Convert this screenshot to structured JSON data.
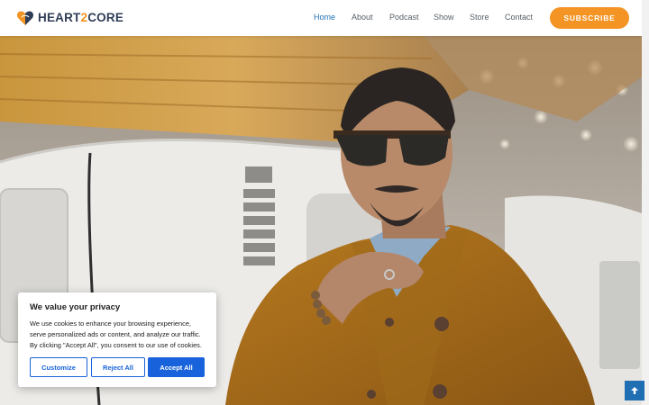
{
  "site": {
    "logo_main": "HEART",
    "logo_accent": "2",
    "logo_end": "CORE"
  },
  "nav": {
    "items": [
      {
        "label": "Home",
        "active": true
      },
      {
        "label": "About",
        "active": false
      },
      {
        "label": "Podcast",
        "active": false
      },
      {
        "label": "Show",
        "active": false
      },
      {
        "label": "Store",
        "active": false
      },
      {
        "label": "Contact",
        "active": false
      }
    ],
    "subscribe_label": "SUBSCRIBE"
  },
  "cookie": {
    "title": "We value your privacy",
    "text": "We use cookies to enhance your browsing experience, serve personalized ads or content, and analyze our traffic. By clicking \"Accept All\", you consent to our use of cookies.",
    "customize_label": "Customize",
    "reject_label": "Reject All",
    "accept_label": "Accept All"
  },
  "icons": {
    "logo": "heart-logo-icon",
    "back_to_top": "arrow-up-icon"
  },
  "colors": {
    "brand_orange": "#f39424",
    "nav_active": "#1f6fb2",
    "cookie_button": "#1863dc"
  }
}
